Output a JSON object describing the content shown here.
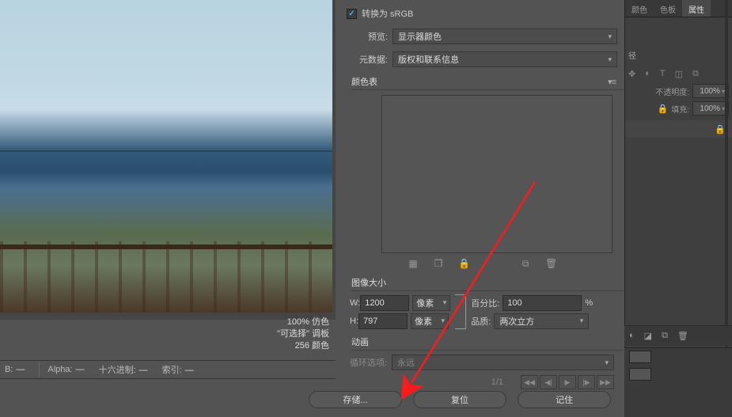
{
  "options": {
    "convert_checkbox_checked": true,
    "convert_label": "转换为 sRGB",
    "preview_label": "预览:",
    "preview_value": "显示器颜色",
    "metadata_label": "元数据:",
    "metadata_value": "版权和联系信息",
    "color_table_title": "颜色表",
    "image_size_title": "图像大小",
    "w_label": "W:",
    "w_value": "1200",
    "h_label": "H:",
    "h_value": "797",
    "unit": "像素",
    "percent_label": "百分比:",
    "percent_value": "100",
    "percent_sign": "%",
    "quality_label": "品质:",
    "quality_value": "两次立方",
    "animation_title": "动画",
    "loop_label": "循环选项:",
    "loop_value": "永远",
    "frame_info": "1/1"
  },
  "info": {
    "line1": "100% 仿色",
    "line2": "\"可选择\" 调板",
    "line3": "256 颜色"
  },
  "status": {
    "b_label": "B:",
    "b_value": "—",
    "alpha_label": "Alpha:",
    "alpha_value": "—",
    "hex_label": "十六进制:",
    "hex_value": "—",
    "index_label": "索引:",
    "index_value": "—"
  },
  "buttons": {
    "save": "存储...",
    "reset": "复位",
    "remember": "记住"
  },
  "right": {
    "tab1": "颜色",
    "tab2": "色板",
    "tab3": "属性",
    "path_hint": "径",
    "opacity_label": "不透明度:",
    "opacity_value": "100%",
    "fill_label": "填充:",
    "fill_value": "100%"
  }
}
